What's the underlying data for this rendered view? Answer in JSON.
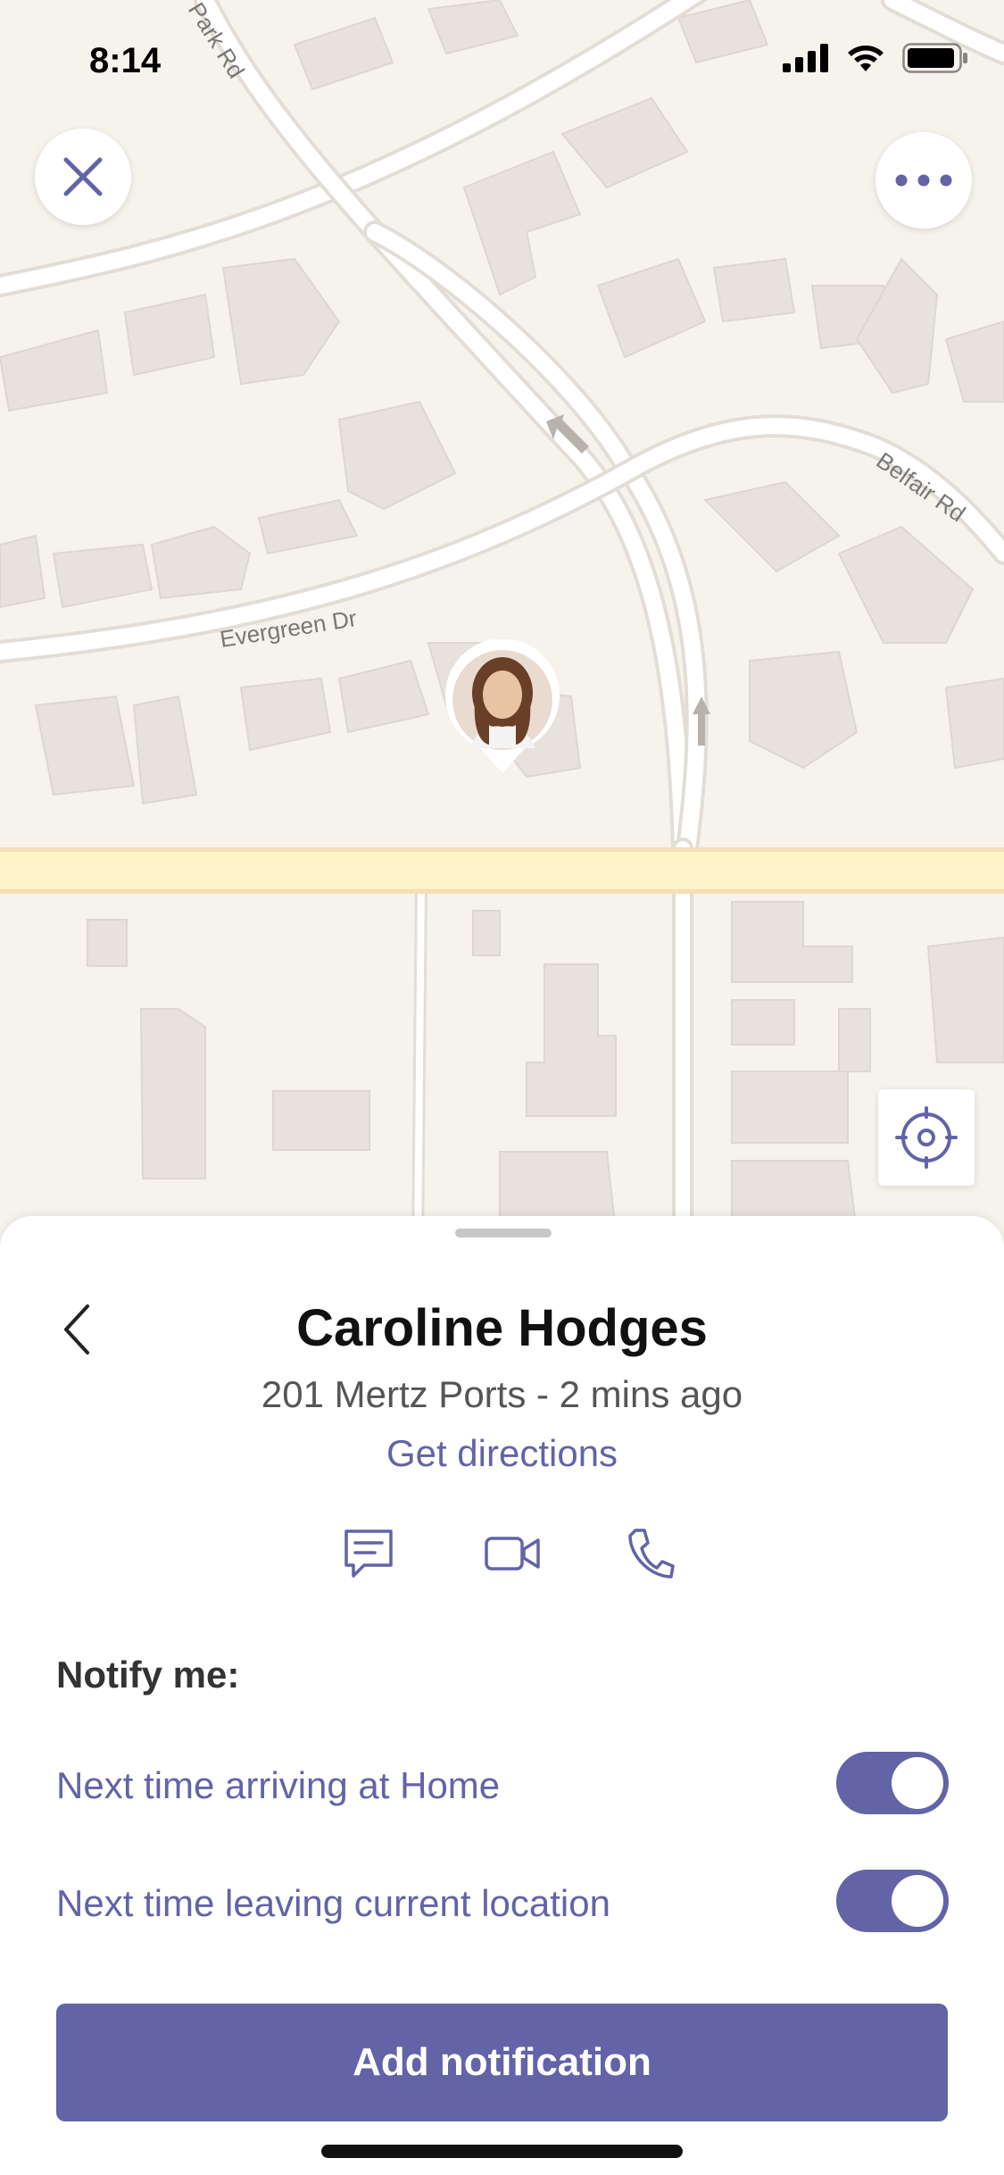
{
  "status_bar": {
    "time": "8:14"
  },
  "map": {
    "street_labels": {
      "park_rd": "Park Rd",
      "belfair_rd": "Belfair Rd",
      "evergreen_dr": "Evergreen Dr"
    },
    "close_icon": "close-icon",
    "more_icon": "more-horizontal-icon",
    "locate_icon": "locate-icon"
  },
  "sheet": {
    "name": "Caroline Hodges",
    "subtitle": "201 Mertz Ports - 2 mins ago",
    "directions_label": "Get directions",
    "actions": [
      {
        "name": "chat",
        "icon": "chat-icon"
      },
      {
        "name": "video",
        "icon": "video-icon"
      },
      {
        "name": "call",
        "icon": "phone-icon"
      }
    ],
    "notify_label": "Notify me:",
    "notifications": [
      {
        "label": "Next time arriving at Home",
        "enabled": true
      },
      {
        "label": "Next time leaving current location",
        "enabled": true
      }
    ],
    "cta_label": "Add notification"
  },
  "colors": {
    "accent": "#6264a7",
    "map_background": "#f6f2ec",
    "major_road": "#fdf3c8"
  }
}
